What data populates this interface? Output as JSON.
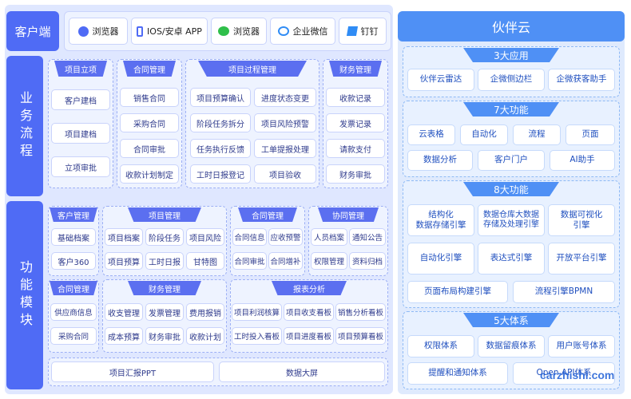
{
  "client": {
    "title": "客户端",
    "items": [
      {
        "label": "浏览器",
        "icon": "compass-icon"
      },
      {
        "label": "IOS/安卓 APP",
        "icon": "phone-icon"
      },
      {
        "label": "浏览器",
        "icon": "wechat-icon"
      },
      {
        "label": "企业微信",
        "icon": "wecom-icon"
      },
      {
        "label": "钉钉",
        "icon": "dingtalk-icon"
      }
    ]
  },
  "left": {
    "business_label": "业务流程",
    "module_label": "功能模块"
  },
  "flow": {
    "xiangmu_lixiang": {
      "title": "项目立项",
      "items": [
        "客户建档",
        "项目建档",
        "立项审批"
      ]
    },
    "hetong": {
      "title": "合同管理",
      "items": [
        "销售合同",
        "采购合同",
        "合同审批",
        "收款计划制定"
      ]
    },
    "guocheng": {
      "title": "项目过程管理",
      "items": [
        "项目预算确认",
        "进度状态变更",
        "阶段任务拆分",
        "项目风险预警",
        "任务执行反馈",
        "工单提报处理",
        "工时日报登记",
        "项目验收"
      ]
    },
    "caiwu": {
      "title": "财务管理",
      "items": [
        "收款记录",
        "发票记录",
        "请款支付",
        "财务审批"
      ]
    }
  },
  "modules": {
    "kehu": {
      "title": "客户管理",
      "items": [
        "基础档案",
        "客户360"
      ]
    },
    "xiangmu": {
      "title": "项目管理",
      "items": [
        "项目档案",
        "阶段任务",
        "项目风险",
        "项目预算",
        "工时日报",
        "甘特图"
      ]
    },
    "hetong2": {
      "title": "合同管理",
      "items": [
        "合同信息",
        "应收预警",
        "合同审批",
        "合同增补"
      ]
    },
    "xietong": {
      "title": "协同管理",
      "items": [
        "人员档案",
        "通知公告",
        "权限管理",
        "资料归档"
      ]
    },
    "hetong3": {
      "title": "合同管理",
      "items": [
        "供应商信息",
        "采购合同"
      ]
    },
    "caiwu2": {
      "title": "财务管理",
      "items": [
        "收支管理",
        "发票管理",
        "费用报销",
        "成本预算",
        "财务审批",
        "收款计划"
      ]
    },
    "baobiao": {
      "title": "报表分析",
      "items": [
        "项目利润核算",
        "项目收支看板",
        "销售分析看板",
        "工时投入看板",
        "项目进度看板",
        "项目预算看板"
      ]
    },
    "bottom": [
      "项目汇报PPT",
      "数据大屏"
    ]
  },
  "right": {
    "title": "伙伴云",
    "apps": {
      "title": "3大应用",
      "items": [
        "伙伴云雷达",
        "企微侧边栏",
        "企微获客助手"
      ]
    },
    "functions": {
      "title": "7大功能",
      "items": [
        "云表格",
        "自动化",
        "流程",
        "页面",
        "数据分析",
        "客户门户",
        "AI助手"
      ]
    },
    "engines": {
      "title": "8大功能",
      "items": [
        "结构化\n数据存储引擎",
        "数据仓库大数据\n存储及处理引擎",
        "数据可视化\n引擎",
        "自动化引擎",
        "表达式引擎",
        "开放平台引擎",
        "页面布局构建引擎",
        "流程引擎BPMN"
      ]
    },
    "systems": {
      "title": "5大体系",
      "items": [
        "权限体系",
        "数据留痕体系",
        "用户账号体系",
        "提醒和通知体系",
        "Open API体系"
      ]
    }
  },
  "watermark": "carzhishi.com",
  "colors": {
    "primary": "#4f6bf5",
    "right_primary": "#4f90f5",
    "section_bg": "#eef3ff"
  }
}
